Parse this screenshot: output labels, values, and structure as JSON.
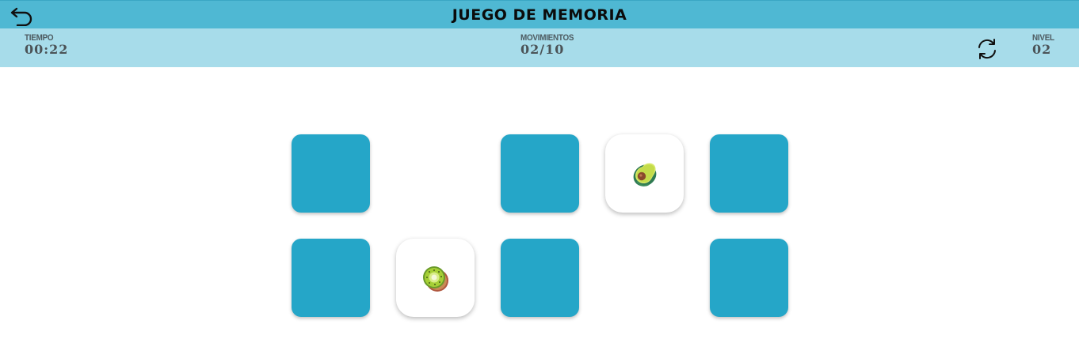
{
  "header": {
    "title": "JUEGO DE MEMORIA",
    "back_icon": "undo-arrow-icon"
  },
  "stats": {
    "time_label": "TIEMPO",
    "time_value": "00:22",
    "moves_label": "MOVIMIENTOS",
    "moves_value": "02/10",
    "level_label": "NIVEL",
    "level_value": "02",
    "refresh_icon": "refresh-icon"
  },
  "board": {
    "rows": 2,
    "cols": 5,
    "cards": [
      {
        "row": 1,
        "col": 1,
        "state": "face-down"
      },
      {
        "row": 1,
        "col": 2,
        "state": "matched-removed"
      },
      {
        "row": 1,
        "col": 3,
        "state": "face-down"
      },
      {
        "row": 1,
        "col": 4,
        "state": "face-up",
        "fruit": "avocado"
      },
      {
        "row": 1,
        "col": 5,
        "state": "face-down"
      },
      {
        "row": 2,
        "col": 1,
        "state": "face-down"
      },
      {
        "row": 2,
        "col": 2,
        "state": "face-up",
        "fruit": "kiwi"
      },
      {
        "row": 2,
        "col": 3,
        "state": "face-down"
      },
      {
        "row": 2,
        "col": 4,
        "state": "matched-removed"
      },
      {
        "row": 2,
        "col": 5,
        "state": "face-down"
      }
    ]
  },
  "colors": {
    "header_bg": "#4fb8d3",
    "status_bg": "#a7dcea",
    "card_back": "#25a6c8",
    "card_front": "#ffffff"
  }
}
